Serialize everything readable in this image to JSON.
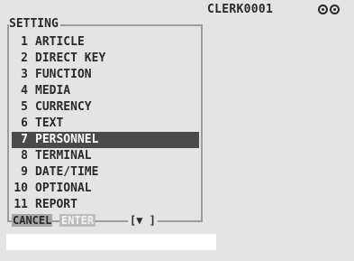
{
  "status": {
    "clerk": "CLERK0001",
    "icons": [
      "ring-icon",
      "ring-icon"
    ]
  },
  "menu": {
    "title": "SETTING",
    "items": [
      {
        "num": "1",
        "label": "ARTICLE"
      },
      {
        "num": "2",
        "label": "DIRECT KEY"
      },
      {
        "num": "3",
        "label": "FUNCTION"
      },
      {
        "num": "4",
        "label": "MEDIA"
      },
      {
        "num": "5",
        "label": "CURRENCY"
      },
      {
        "num": "6",
        "label": "TEXT"
      },
      {
        "num": "7",
        "label": "PERSONNEL"
      },
      {
        "num": "8",
        "label": "TERMINAL"
      },
      {
        "num": "9",
        "label": "DATE/TIME"
      },
      {
        "num": "10",
        "label": "OPTIONAL"
      },
      {
        "num": "11",
        "label": "REPORT"
      }
    ],
    "selected_index": 6
  },
  "footer": {
    "cancel": "CANCEL",
    "enter": "ENTER",
    "scroll": "[▼ ]"
  },
  "entry": {
    "value": ""
  }
}
